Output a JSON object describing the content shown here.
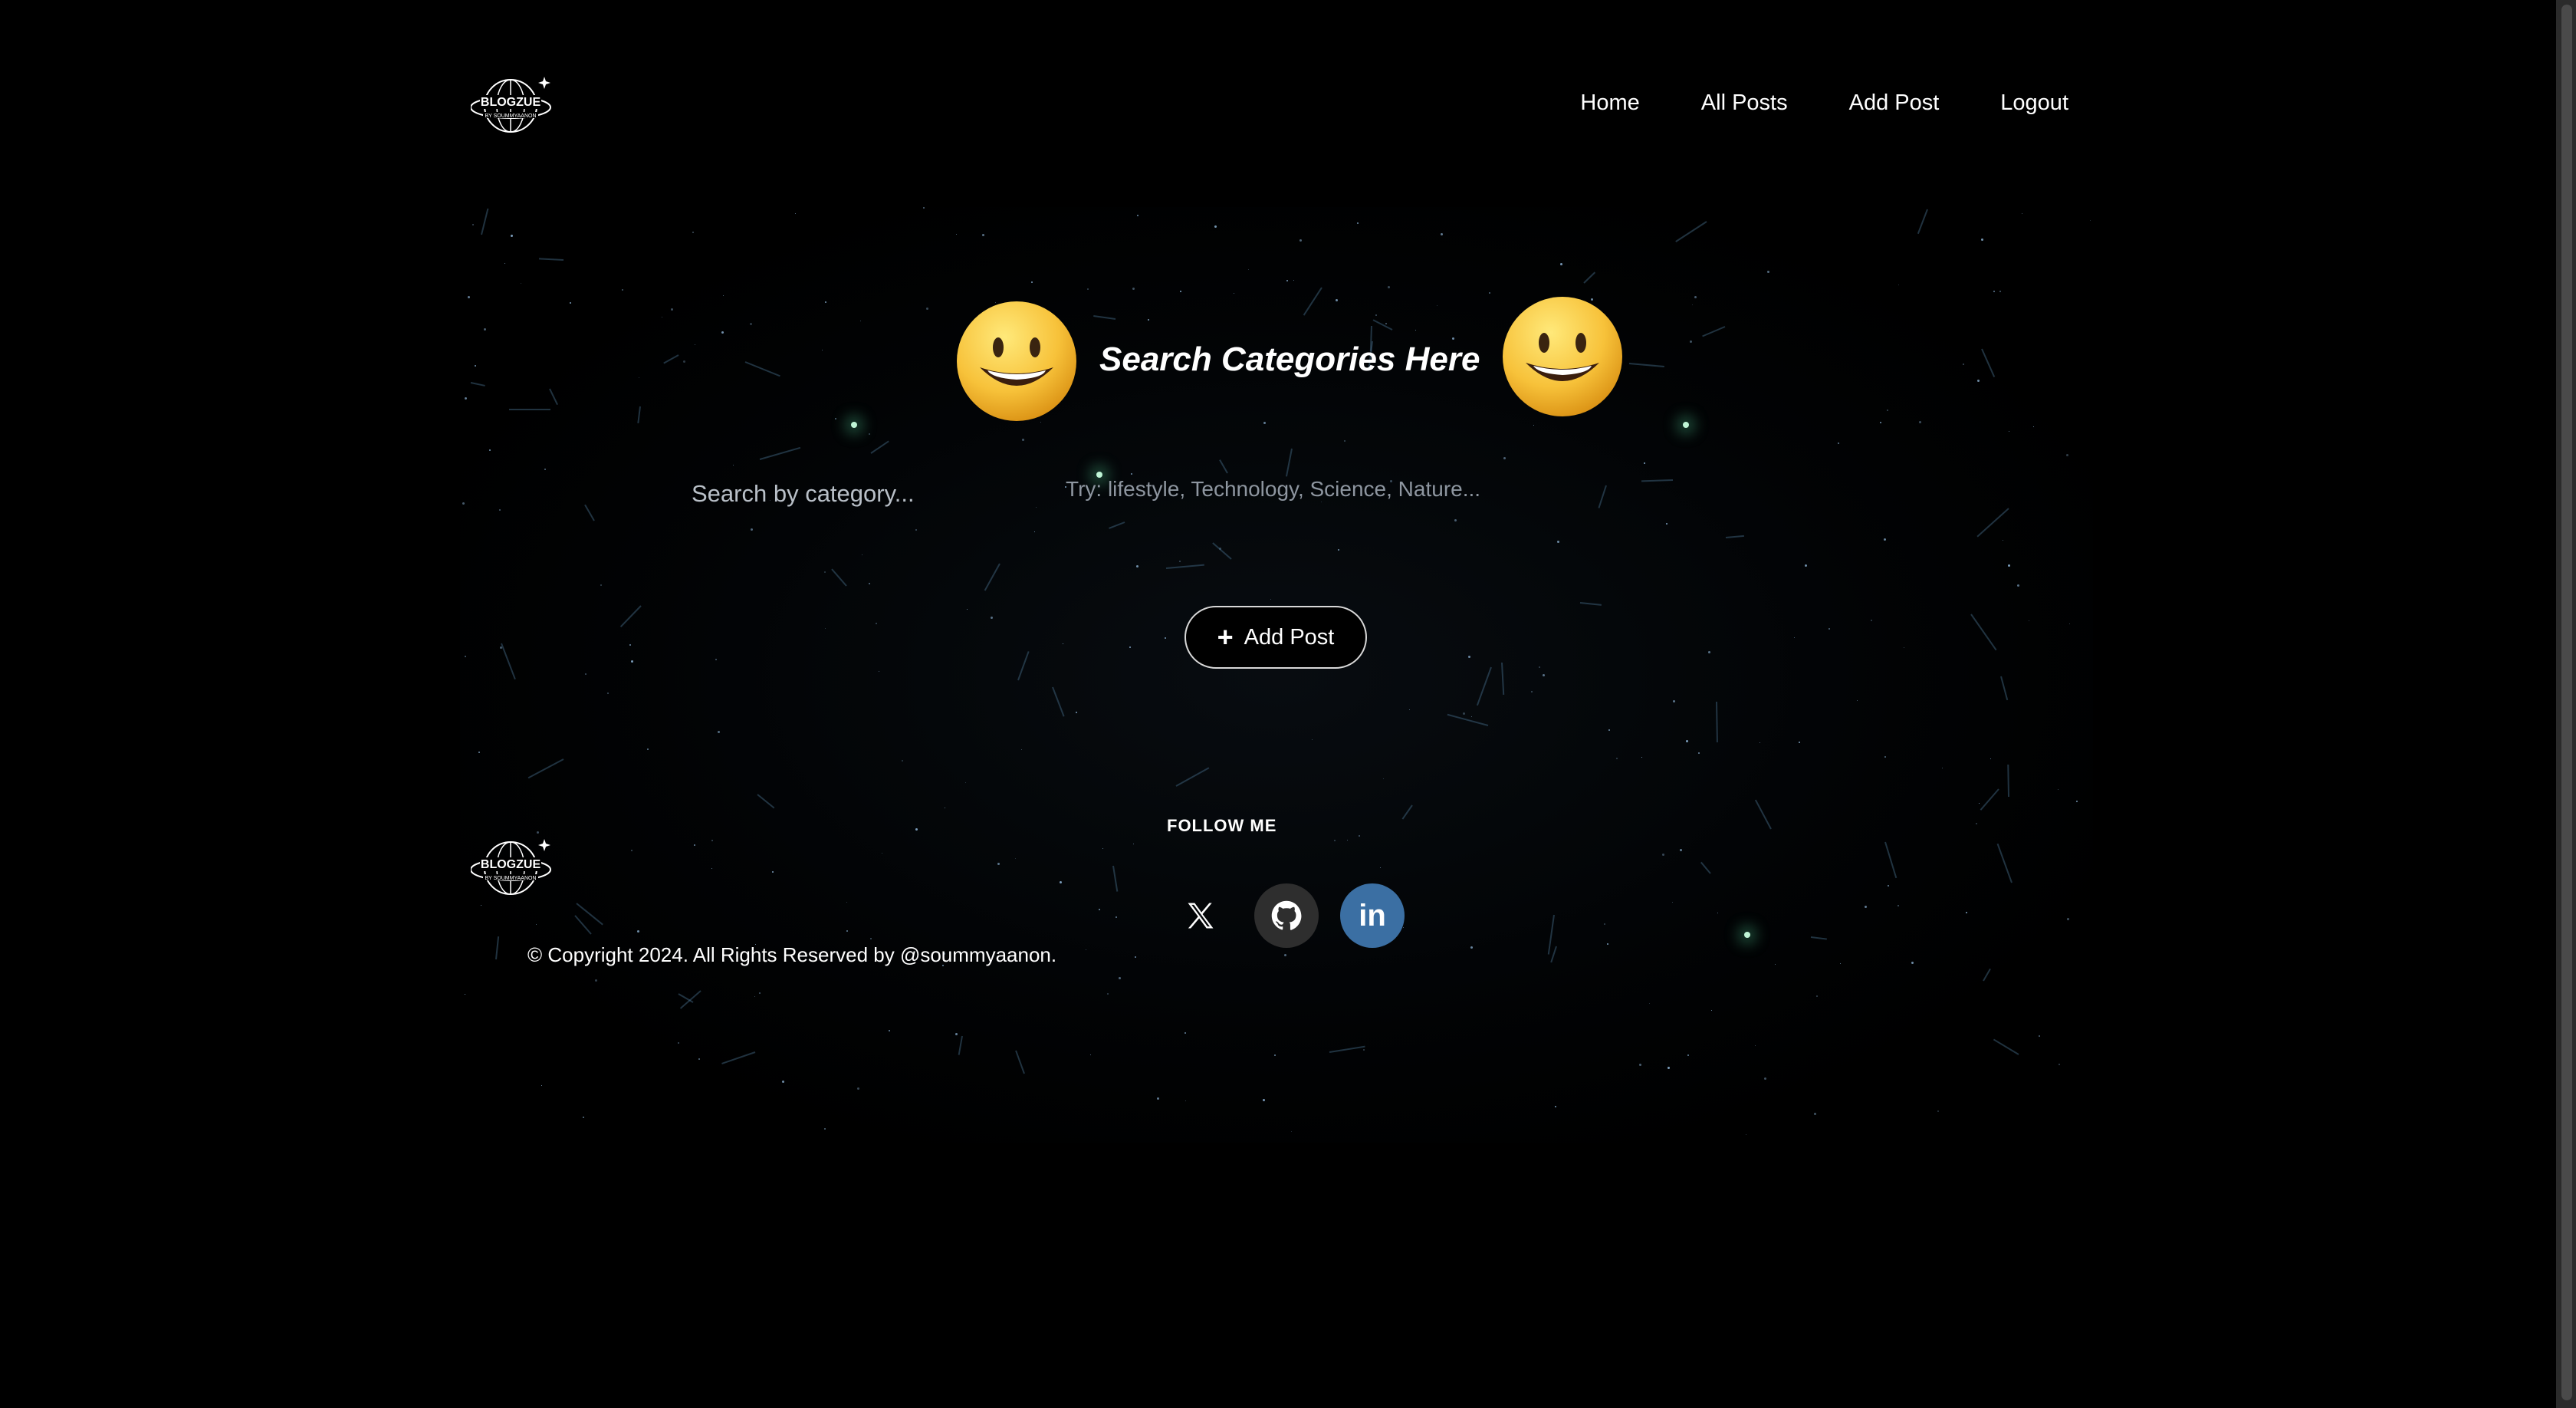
{
  "header": {
    "logo_text": "BLOGZUE",
    "logo_subtext": "BY SOUMMYAANON",
    "nav": [
      {
        "label": "Home"
      },
      {
        "label": "All Posts"
      },
      {
        "label": "Add Post"
      },
      {
        "label": "Logout"
      }
    ]
  },
  "main": {
    "heading": "Search Categories Here",
    "emoji_icon": "grinning-face-icon",
    "search": {
      "placeholder": "Search by category...",
      "value": "",
      "hint": "Try: lifestyle, Technology, Science, Nature..."
    },
    "add_post_button": "Add Post"
  },
  "footer": {
    "follow_label": "FOLLOW ME",
    "copyright": "© Copyright 2024. All Rights Reserved by @soummyaanon.",
    "socials": [
      {
        "icon": "x-twitter-icon",
        "color": "#000000"
      },
      {
        "icon": "github-icon",
        "color": "#2e2e2e"
      },
      {
        "icon": "linkedin-icon",
        "color": "#3b6fa3",
        "text": "in"
      }
    ]
  },
  "colors": {
    "background": "#000000",
    "hint_text": "#8e96a0",
    "linkedin": "#3b6fa3"
  }
}
